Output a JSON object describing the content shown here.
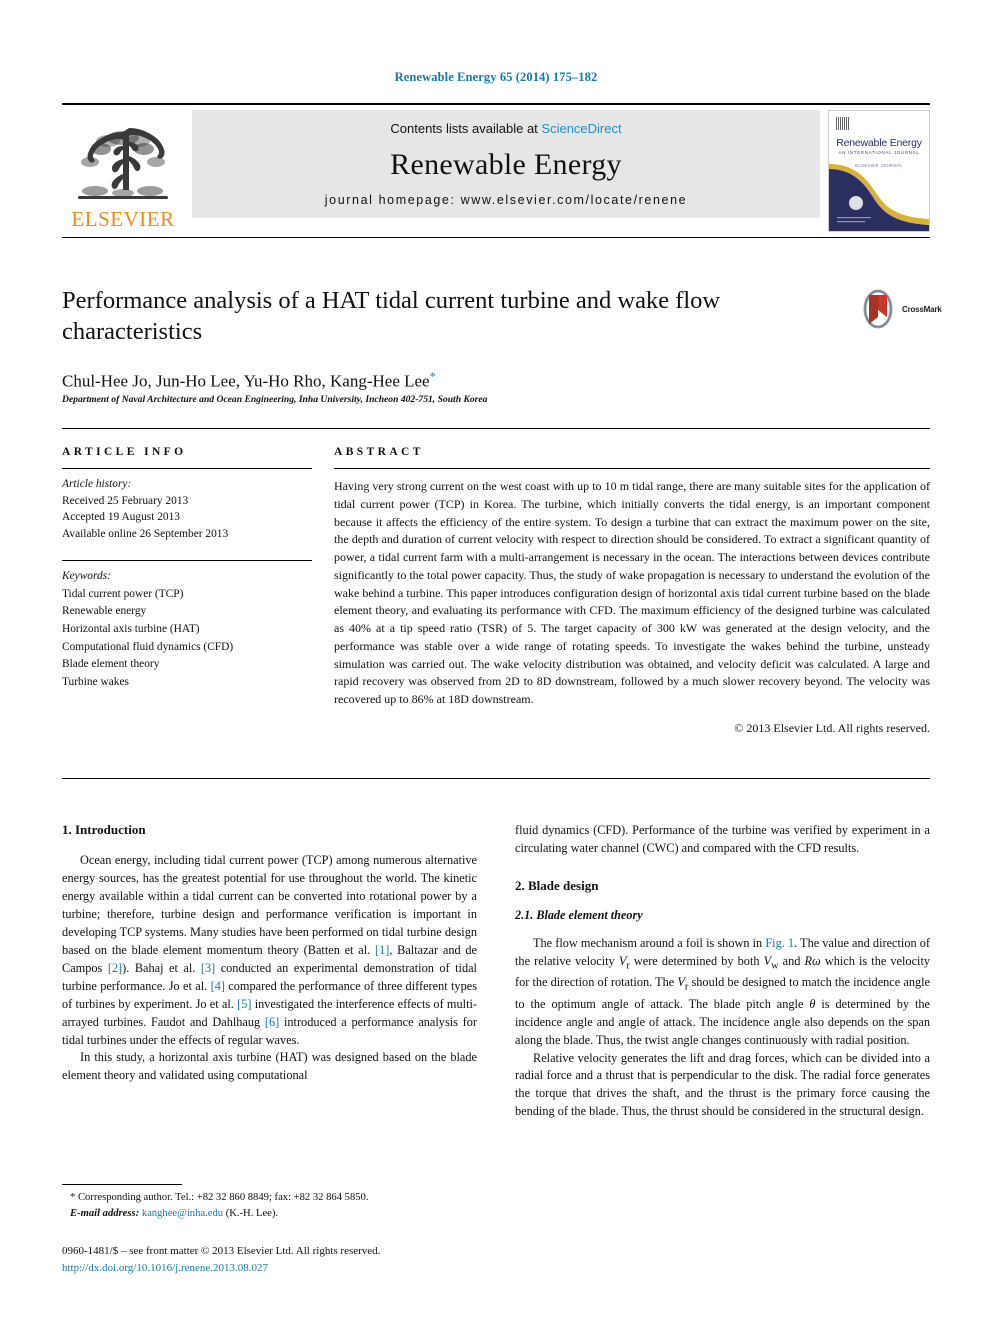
{
  "running_head": "Renewable Energy 65 (2014) 175–182",
  "masthead": {
    "publisher_name": "ELSEVIER",
    "contents_prefix": "Contents lists available at ",
    "contents_link": "ScienceDirect",
    "journal_name": "Renewable Energy",
    "homepage": "journal homepage: www.elsevier.com/locate/renene",
    "cover": {
      "title": "Renewable Energy",
      "subtitle": "AN INTERNATIONAL JOURNAL",
      "subtitle2": "ELSEVIER JOURNAL"
    }
  },
  "article": {
    "title": "Performance analysis of a HAT tidal current turbine and wake flow characteristics",
    "authors": "Chul-Hee Jo, Jun-Ho Lee, Yu-Ho Rho, Kang-Hee Lee",
    "author_star": "*",
    "affiliation": "Department of Naval Architecture and Ocean Engineering, Inha University, Incheon 402-751, South Korea",
    "crossmark_label": "CrossMark"
  },
  "article_info": {
    "heading": "ARTICLE INFO",
    "history_label": "Article history:",
    "history": [
      "Received 25 February 2013",
      "Accepted 19 August 2013",
      "Available online 26 September 2013"
    ],
    "keywords_label": "Keywords:",
    "keywords": [
      "Tidal current power (TCP)",
      "Renewable energy",
      "Horizontal axis turbine (HAT)",
      "Computational fluid dynamics (CFD)",
      "Blade element theory",
      "Turbine wakes"
    ]
  },
  "abstract": {
    "heading": "ABSTRACT",
    "text": "Having very strong current on the west coast with up to 10 m tidal range, there are many suitable sites for the application of tidal current power (TCP) in Korea. The turbine, which initially converts the tidal energy, is an important component because it affects the efficiency of the entire system. To design a turbine that can extract the maximum power on the site, the depth and duration of current velocity with respect to direction should be considered. To extract a significant quantity of power, a tidal current farm with a multi-arrangement is necessary in the ocean. The interactions between devices contribute significantly to the total power capacity. Thus, the study of wake propagation is necessary to understand the evolution of the wake behind a turbine. This paper introduces configuration design of horizontal axis tidal current turbine based on the blade element theory, and evaluating its performance with CFD. The maximum efficiency of the designed turbine was calculated as 40% at a tip speed ratio (TSR) of 5. The target capacity of 300 kW was generated at the design velocity, and the performance was stable over a wide range of rotating speeds. To investigate the wakes behind the turbine, unsteady simulation was carried out. The wake velocity distribution was obtained, and velocity deficit was calculated. A large and rapid recovery was observed from 2D to 8D downstream, followed by a much slower recovery beyond. The velocity was recovered up to 86% at 18D downstream.",
    "copyright": "© 2013 Elsevier Ltd. All rights reserved."
  },
  "body": {
    "intro_heading": "1. Introduction",
    "intro_p1_a": "Ocean energy, including tidal current power (TCP) among numerous alternative energy sources, has the greatest potential for use throughout the world. The kinetic energy available within a tidal current can be converted into rotational power by a turbine; therefore, turbine design and performance verification is important in developing TCP systems. Many studies have been performed on tidal turbine design based on the blade element momentum theory (Batten et al. ",
    "ref1": "[1]",
    "intro_p1_b": ", Baltazar and de Campos ",
    "ref2": "[2]",
    "intro_p1_c": "). Bahaj et al. ",
    "ref3": "[3]",
    "intro_p1_d": " conducted an experimental demonstration of tidal turbine performance. Jo et al. ",
    "ref4": "[4]",
    "intro_p1_e": " compared the performance of three different types of turbines by experiment. Jo et al. ",
    "ref5": "[5]",
    "intro_p1_f": " investigated the interference effects of multi-arrayed turbines. Faudot and Dahlhaug ",
    "ref6": "[6]",
    "intro_p1_g": " introduced a performance analysis for tidal turbines under the effects of regular waves.",
    "intro_p2": "In this study, a horizontal axis turbine (HAT) was designed based on the blade element theory and validated using computational",
    "right_p1": "fluid dynamics (CFD). Performance of the turbine was verified by experiment in a circulating water channel (CWC) and compared with the CFD results.",
    "blade_design_heading": "2. Blade design",
    "blade_element_heading": "2.1. Blade element theory",
    "right_p2_a": "The flow mechanism around a foil is shown in ",
    "fig1_ref": "Fig. 1",
    "right_p2_b": ". The value and direction of the relative velocity ",
    "var_vr": "V",
    "var_vr_sub": "r",
    "right_p2_c": " were determined by both ",
    "var_vw": "V",
    "var_vw_sub": "w",
    "right_p2_d": " and ",
    "var_romega": "Rω",
    "right_p2_e": " which is the velocity for the direction of rotation. The ",
    "right_p2_f": " should be designed to match the incidence angle to the optimum angle of attack. The blade pitch angle ",
    "var_theta": "θ",
    "right_p2_g": " is determined by the incidence angle and angle of attack. The incidence angle also depends on the span along the blade. Thus, the twist angle changes continuously with radial position.",
    "right_p3": "Relative velocity generates the lift and drag forces, which can be divided into a radial force and a thrust that is perpendicular to the disk. The radial force generates the torque that drives the shaft, and the thrust is the primary force causing the bending of the blade. Thus, the thrust should be considered in the structural design."
  },
  "footnote": {
    "corresponding": "* Corresponding author. Tel.: +82 32 860 8849; fax: +82 32 864 5850.",
    "email_label": "E-mail address:",
    "email": "kanghee@inha.edu",
    "email_owner": "(K.-H. Lee)."
  },
  "issn_footer": {
    "line1": "0960-1481/$ – see front matter © 2013 Elsevier Ltd. All rights reserved.",
    "doi": "http://dx.doi.org/10.1016/j.renene.2013.08.027"
  },
  "colors": {
    "link": "#1878a8",
    "elsevier_orange": "#ec8b1f",
    "band_gray": "#e6e6e6",
    "cover_navy": "#2a2f60"
  }
}
